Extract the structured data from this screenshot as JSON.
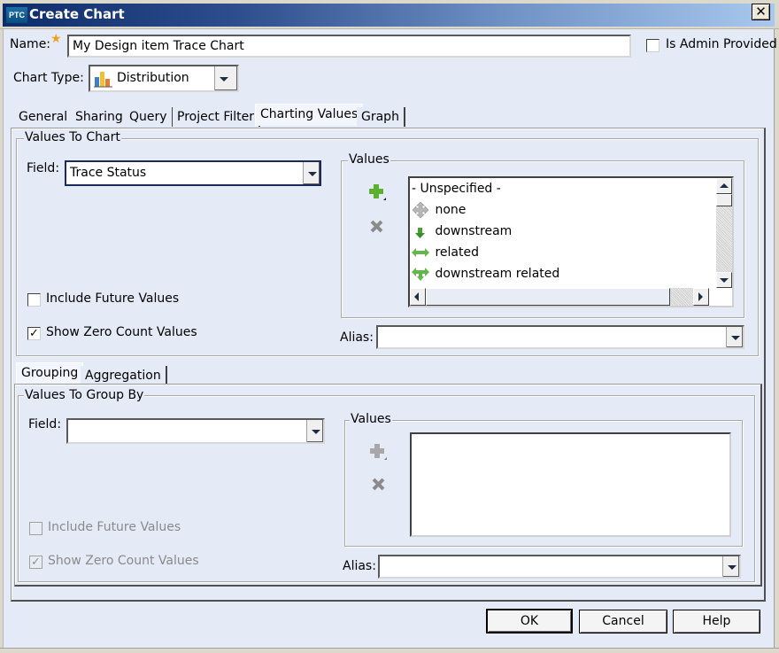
{
  "window": {
    "logo": "PTC",
    "title": "Create Chart",
    "close_glyph": "✕"
  },
  "header": {
    "name_label": "Name:",
    "required_glyph": "★",
    "name_value": "My Design item Trace Chart",
    "admin_checkbox_label": "Is Admin Provided",
    "admin_checked": false,
    "chart_type_label": "Chart Type:",
    "chart_type_value": "Distribution"
  },
  "tabs": [
    {
      "label": "General",
      "active": false
    },
    {
      "label": "Sharing",
      "active": false
    },
    {
      "label": "Query",
      "active": false
    },
    {
      "label": "Project Filter",
      "active": false
    },
    {
      "label": "Charting Values",
      "active": true
    },
    {
      "label": "Graph",
      "active": false
    }
  ],
  "values_to_chart": {
    "group_title": "Values To Chart",
    "field_label": "Field:",
    "field_value": "Trace Status",
    "values_group_title": "Values",
    "add_icon": "plus-icon",
    "remove_icon": "x-icon",
    "list_items": [
      {
        "label": "- Unspecified -",
        "icon": ""
      },
      {
        "label": "none",
        "icon": "move-cross-icon"
      },
      {
        "label": "downstream",
        "icon": "arrow-down-icon"
      },
      {
        "label": "related",
        "icon": "arrow-left-right-icon"
      },
      {
        "label": "downstream related",
        "icon": "arrow-down-left-right-icon"
      }
    ],
    "include_future_label": "Include Future Values",
    "include_future_checked": false,
    "show_zero_label": "Show Zero Count Values",
    "show_zero_checked": true,
    "check_glyph": "✓",
    "alias_label": "Alias:",
    "alias_value": ""
  },
  "sub_tabs": [
    {
      "label": "Grouping",
      "active": true
    },
    {
      "label": "Aggregation",
      "active": false
    }
  ],
  "values_to_group_by": {
    "group_title": "Values To Group By",
    "field_label": "Field:",
    "field_value": "",
    "values_group_title": "Values",
    "include_future_label": "Include Future Values",
    "include_future_checked": false,
    "show_zero_label": "Show Zero Count Values",
    "show_zero_checked": true,
    "alias_label": "Alias:",
    "alias_value": ""
  },
  "buttons": {
    "ok": "OK",
    "cancel": "Cancel",
    "help": "Help"
  }
}
